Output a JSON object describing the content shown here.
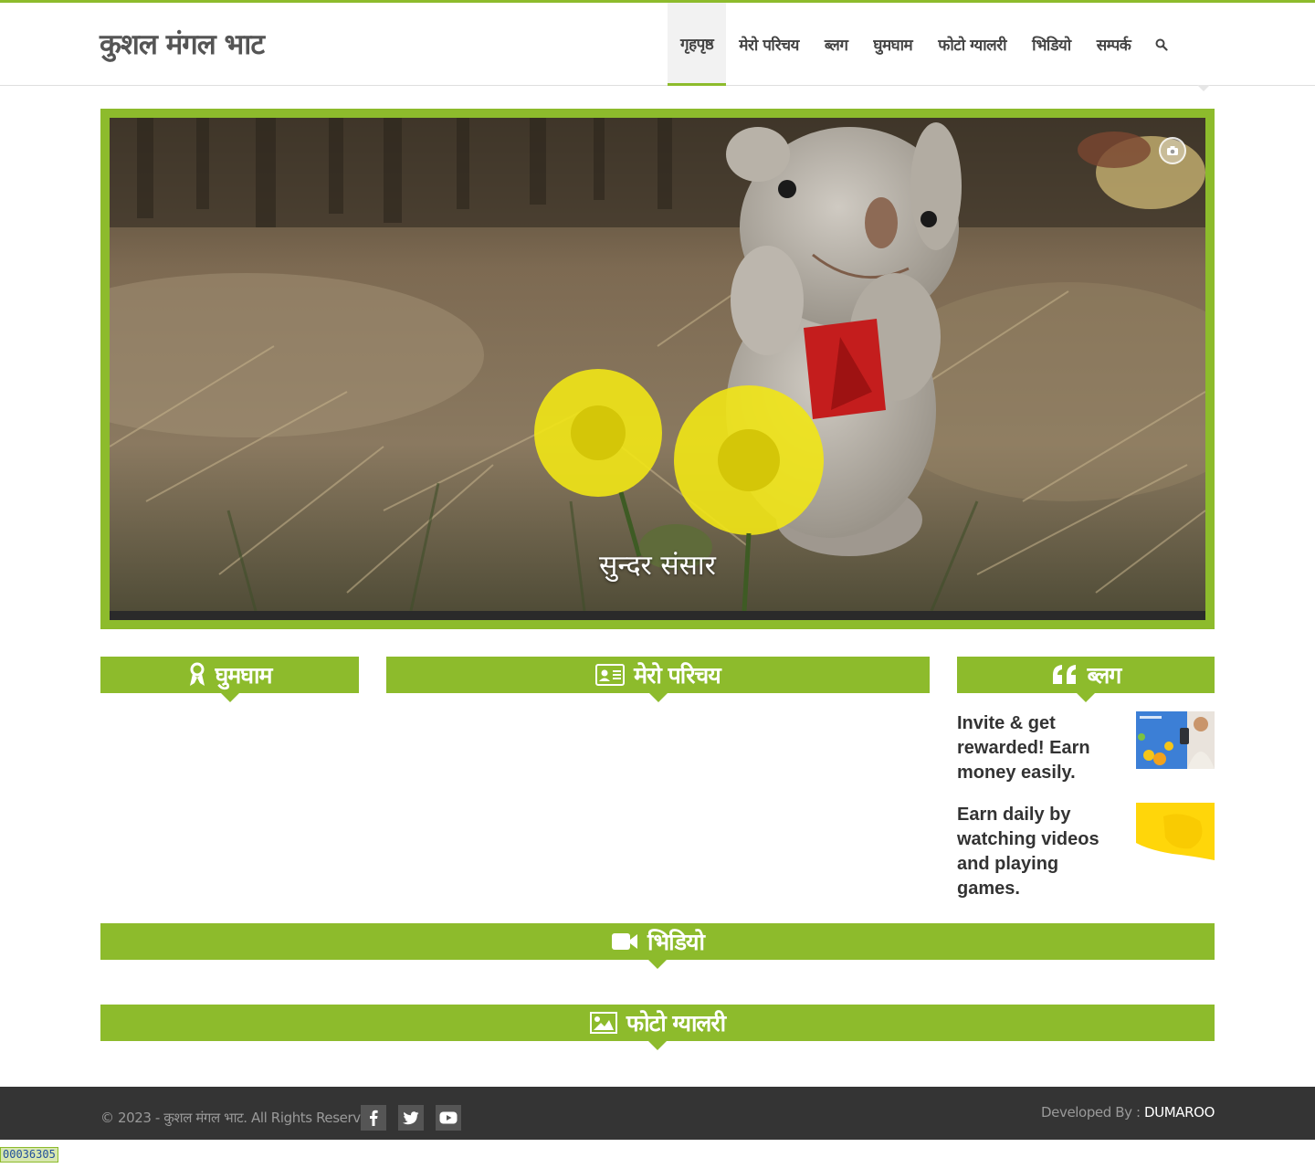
{
  "site": {
    "title": "कुशल मंगल भाट"
  },
  "nav": {
    "items": [
      {
        "label": "गृहपृष्ठ",
        "active": true
      },
      {
        "label": "मेरो परिचय"
      },
      {
        "label": "ब्लग"
      },
      {
        "label": "घुमघाम"
      },
      {
        "label": "फोटो ग्यालरी"
      },
      {
        "label": "भिडियो"
      },
      {
        "label": "सम्पर्क"
      }
    ],
    "search_icon": "search-icon"
  },
  "slider": {
    "caption": "सुन्दर संसार",
    "camera_icon": "camera-icon"
  },
  "sections": {
    "ghumgham": {
      "title": "घुमघाम",
      "icon": "ribbon-icon"
    },
    "parichaya": {
      "title": "मेरो परिचय",
      "icon": "id-card-icon"
    },
    "blog": {
      "title": "ब्लग",
      "icon": "quote-icon"
    },
    "video": {
      "title": "भिडियो",
      "icon": "video-camera-icon"
    },
    "gallery": {
      "title": "फोटो ग्यालरी",
      "icon": "picture-icon"
    }
  },
  "blog_posts": [
    {
      "title": "Invite & get rewarded! Earn money easily."
    },
    {
      "title": "Earn daily by watching videos and playing games."
    }
  ],
  "footer": {
    "copyright": "© 2023 - कुशल मंगल भाट. All Rights Reserved.",
    "developed_by_label": "Developed By :",
    "developer": "DUMAROO",
    "social": [
      "facebook-icon",
      "twitter-icon",
      "youtube-icon"
    ]
  },
  "counter": "00036305",
  "colors": {
    "accent": "#8dbb2c",
    "footer": "#343434"
  }
}
